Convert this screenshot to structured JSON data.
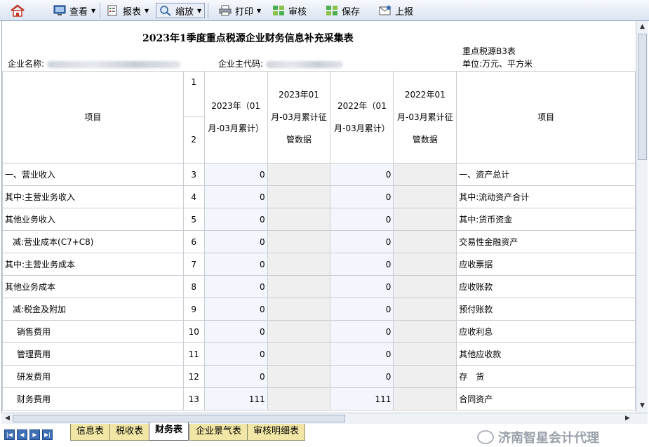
{
  "toolbar": {
    "view": "查看",
    "report": "报表",
    "zoom": "缩放",
    "print": "打印",
    "audit": "审核",
    "save": "保存",
    "upload": "上报"
  },
  "form": {
    "title": "2023年1季度重点税源企业财务信息补充采集表",
    "company_name_label": "企业名称:",
    "company_code_label": "企业主代码:",
    "table_id": "重点税源B3表",
    "unit": "单位:万元、平方米"
  },
  "header": {
    "item": "项目",
    "row_no_1": "1",
    "row_no_2": "2",
    "col_2023": "2023年（01月-03月累计）",
    "col_2023_tax": "2023年01月-03月累计征管数据",
    "col_2022": "2022年（01月-03月累计）",
    "col_2022_tax": "2022年01月-03月累计征管数据",
    "item_right": "项目"
  },
  "rows": [
    {
      "item": "一、营业收入",
      "no": "3",
      "v2023": "0",
      "v2022": "0",
      "right": "一、资产总计"
    },
    {
      "item": "其中:主营业务收入",
      "no": "4",
      "v2023": "0",
      "v2022": "0",
      "right": "其中:流动资产合计"
    },
    {
      "item": "其他业务收入",
      "no": "5",
      "v2023": "0",
      "v2022": "0",
      "right": "其中:货币资金"
    },
    {
      "item": "减:营业成本(C7+C8)",
      "no": "6",
      "v2023": "0",
      "v2022": "0",
      "right": "交易性金融资产"
    },
    {
      "item": "其中:主营业务成本",
      "no": "7",
      "v2023": "0",
      "v2022": "0",
      "right": "应收票据"
    },
    {
      "item": "其他业务成本",
      "no": "8",
      "v2023": "0",
      "v2022": "0",
      "right": "应收账款"
    },
    {
      "item": "减:税金及附加",
      "no": "9",
      "v2023": "0",
      "v2022": "0",
      "right": "预付账款"
    },
    {
      "item": "销售费用",
      "no": "10",
      "v2023": "0",
      "v2022": "0",
      "right": "应收利息"
    },
    {
      "item": "管理费用",
      "no": "11",
      "v2023": "0",
      "v2022": "0",
      "right": "其他应收款"
    },
    {
      "item": "研发费用",
      "no": "12",
      "v2023": "0",
      "v2022": "0",
      "right": "存　货"
    },
    {
      "item": "财务费用",
      "no": "13",
      "v2023": "111",
      "v2022": "111",
      "right": "合同资产"
    }
  ],
  "tabs": [
    "信息表",
    "税收表",
    "财务表",
    "企业景气表",
    "审核明细表"
  ],
  "active_tab": "财务表",
  "watermark": "济南智星会计代理"
}
